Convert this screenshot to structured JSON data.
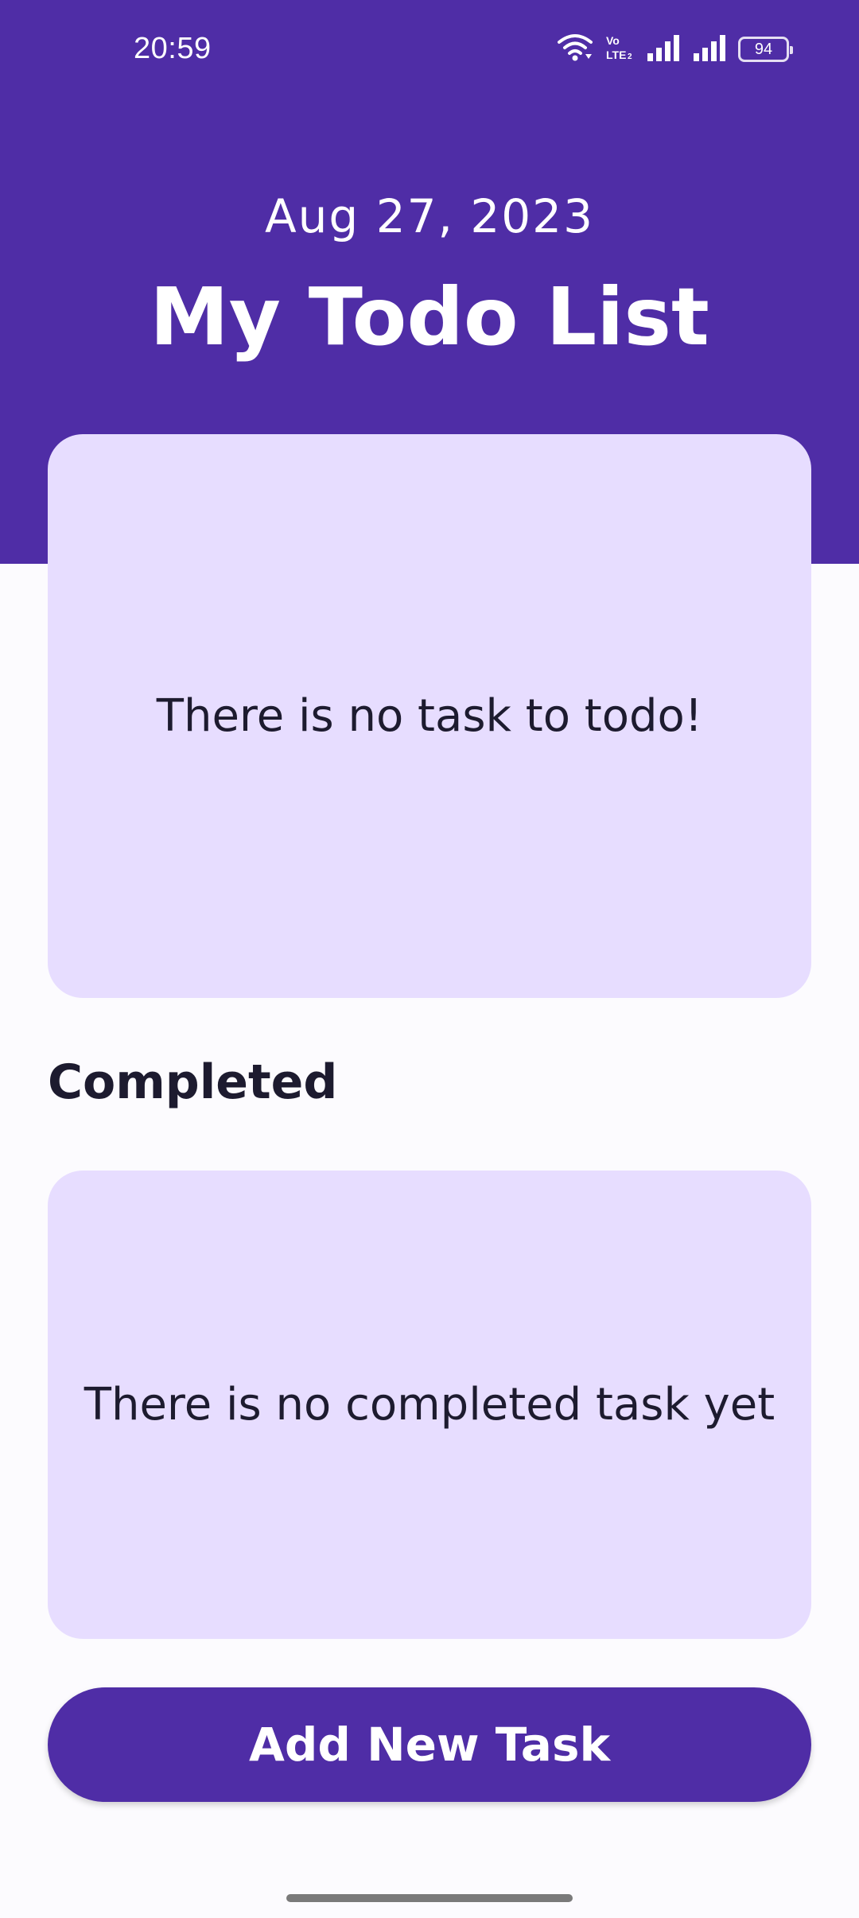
{
  "status_bar": {
    "time": "20:59",
    "battery_level": "94",
    "icons": [
      "wifi-icon",
      "volte-icon",
      "signal-icon-1",
      "signal-icon-2",
      "battery-icon"
    ]
  },
  "header": {
    "date": "Aug 27, 2023",
    "title": "My Todo List"
  },
  "todo_section": {
    "empty_message": "There is no task to todo!"
  },
  "completed_section": {
    "heading": "Completed",
    "empty_message": "There is no completed task yet"
  },
  "add_task_button": {
    "label": "Add New Task"
  },
  "colors": {
    "primary": "#4F2DA6",
    "card_background": "#E7DDFF",
    "page_background": "#FCFBFE",
    "text_dark": "#1D1B2F"
  }
}
